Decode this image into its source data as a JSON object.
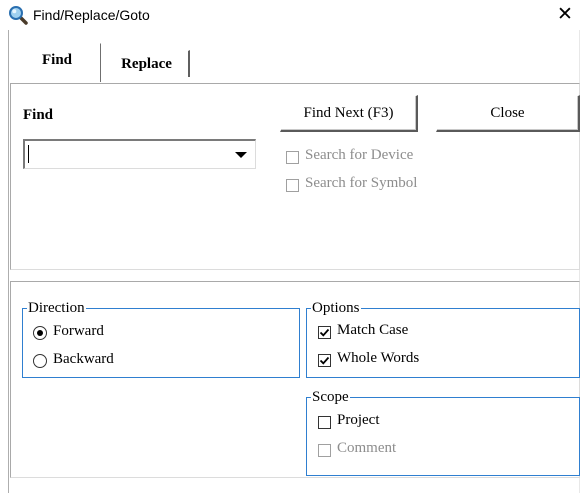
{
  "window": {
    "title": "Find/Replace/Goto",
    "close_glyph": "✕"
  },
  "tabs": [
    {
      "label": "Find",
      "selected": true
    },
    {
      "label": "Replace",
      "selected": false
    }
  ],
  "find": {
    "label": "Find",
    "value": "",
    "find_next_label": "Find Next (F3)",
    "close_label": "Close",
    "search_device": {
      "label": "Search for Device",
      "checked": false,
      "enabled": false
    },
    "search_symbol": {
      "label": "Search for Symbol",
      "checked": false,
      "enabled": false
    }
  },
  "direction": {
    "legend": "Direction",
    "forward": {
      "label": "Forward",
      "selected": true
    },
    "backward": {
      "label": "Backward",
      "selected": false
    }
  },
  "options": {
    "legend": "Options",
    "match_case": {
      "label": "Match Case",
      "checked": true
    },
    "whole_words": {
      "label": "Whole Words",
      "checked": true
    }
  },
  "scope": {
    "legend": "Scope",
    "project": {
      "label": "Project",
      "checked": false,
      "enabled": true
    },
    "comment": {
      "label": "Comment",
      "checked": false,
      "enabled": false
    }
  },
  "icons": {
    "title": "magnifier-icon",
    "combo_arrow": "triangle-down-icon",
    "close": "close-icon"
  },
  "colors": {
    "group_border": "#2f7fd0",
    "disabled_text": "#8d8d8d"
  }
}
